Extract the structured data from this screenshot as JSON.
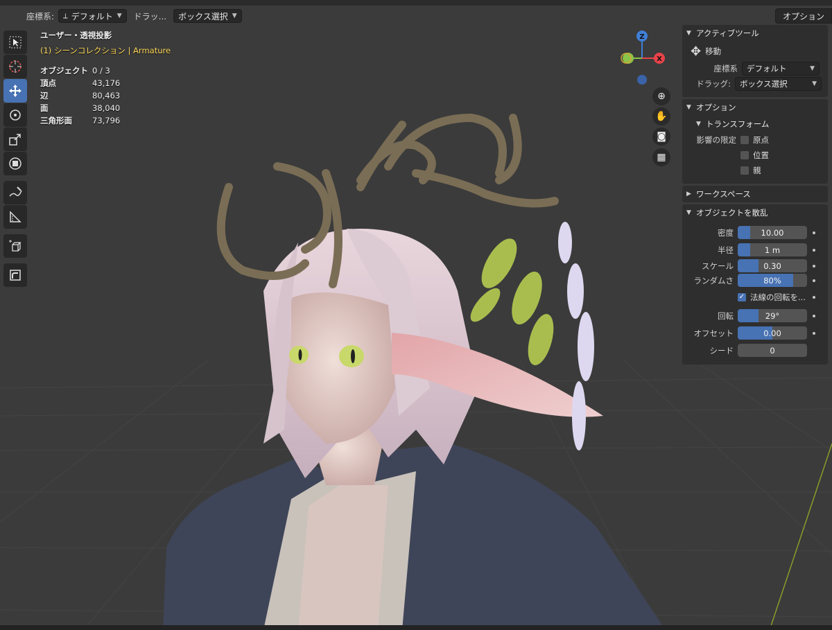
{
  "header": {
    "transform_orientation_label": "座標系:",
    "transform_orientation_value": "デフォルト",
    "drag_label": "ドラッ...",
    "drag_value": "ボックス選択",
    "options_button": "オプション"
  },
  "toolbar": {
    "tools": [
      "select-box-icon",
      "cursor-icon",
      "move-icon",
      "rotate-icon",
      "scale-icon",
      "transform-icon",
      "annotate-icon",
      "measure-icon",
      "add-cube-icon",
      "shear-icon"
    ],
    "active_tool": "move-icon"
  },
  "overlay": {
    "view_title": "ユーザー・透視投影",
    "collection": "(1) シーンコレクション | Armature",
    "stats": [
      {
        "label": "オブジェクト",
        "value": "0 / 3"
      },
      {
        "label": "頂点",
        "value": "43,176"
      },
      {
        "label": "辺",
        "value": "80,463"
      },
      {
        "label": "面",
        "value": "38,040"
      },
      {
        "label": "三角形面",
        "value": "73,796"
      }
    ]
  },
  "gizmo": {
    "z_label": "Z",
    "x_label": "X",
    "colors": {
      "x": "#e8434a",
      "y": "#8bc34a",
      "z": "#3f7fd6"
    },
    "nav_buttons": [
      "zoom-icon",
      "hand-pan-icon",
      "camera-icon",
      "grid-perspective-icon"
    ]
  },
  "panel": {
    "active_tool": {
      "title": "アクティブツール",
      "tool_name": "移動",
      "orientation_label": "座標系",
      "orientation_value": "デフォルト",
      "drag_label": "ドラッグ:",
      "drag_value": "ボックス選択"
    },
    "options": {
      "title": "オプション",
      "transform_title": "トランスフォーム",
      "affect_only_label": "影響の限定",
      "origins": "原点",
      "locations": "位置",
      "parents": "親"
    },
    "workspace": {
      "title": "ワークスペース"
    },
    "scatter": {
      "title": "オブジェクトを散乱",
      "density_label": "密度",
      "density_value": "10.00",
      "density_fill": 0.18,
      "radius_label": "半径",
      "radius_value": "1 m",
      "radius_fill": 0.18,
      "scale_label": "スケール",
      "scale_value": "0.30",
      "scale_fill": 0.3,
      "random_label": "ランダムさ",
      "random_value": "80%",
      "random_fill": 0.8,
      "normal_rotation_label": "法線の回転を...",
      "rotation_label": "回転",
      "rotation_value": "29°",
      "rotation_fill": 0.3,
      "offset_label": "オフセット",
      "offset_value": "0.00",
      "offset_fill": 0.5,
      "seed_label": "シード",
      "seed_value": "0"
    }
  },
  "colors": {
    "accent": "#4772b3",
    "panel": "#2e2e2e",
    "viewport": "#3b3b3b",
    "collection_text": "#ffd95a"
  }
}
